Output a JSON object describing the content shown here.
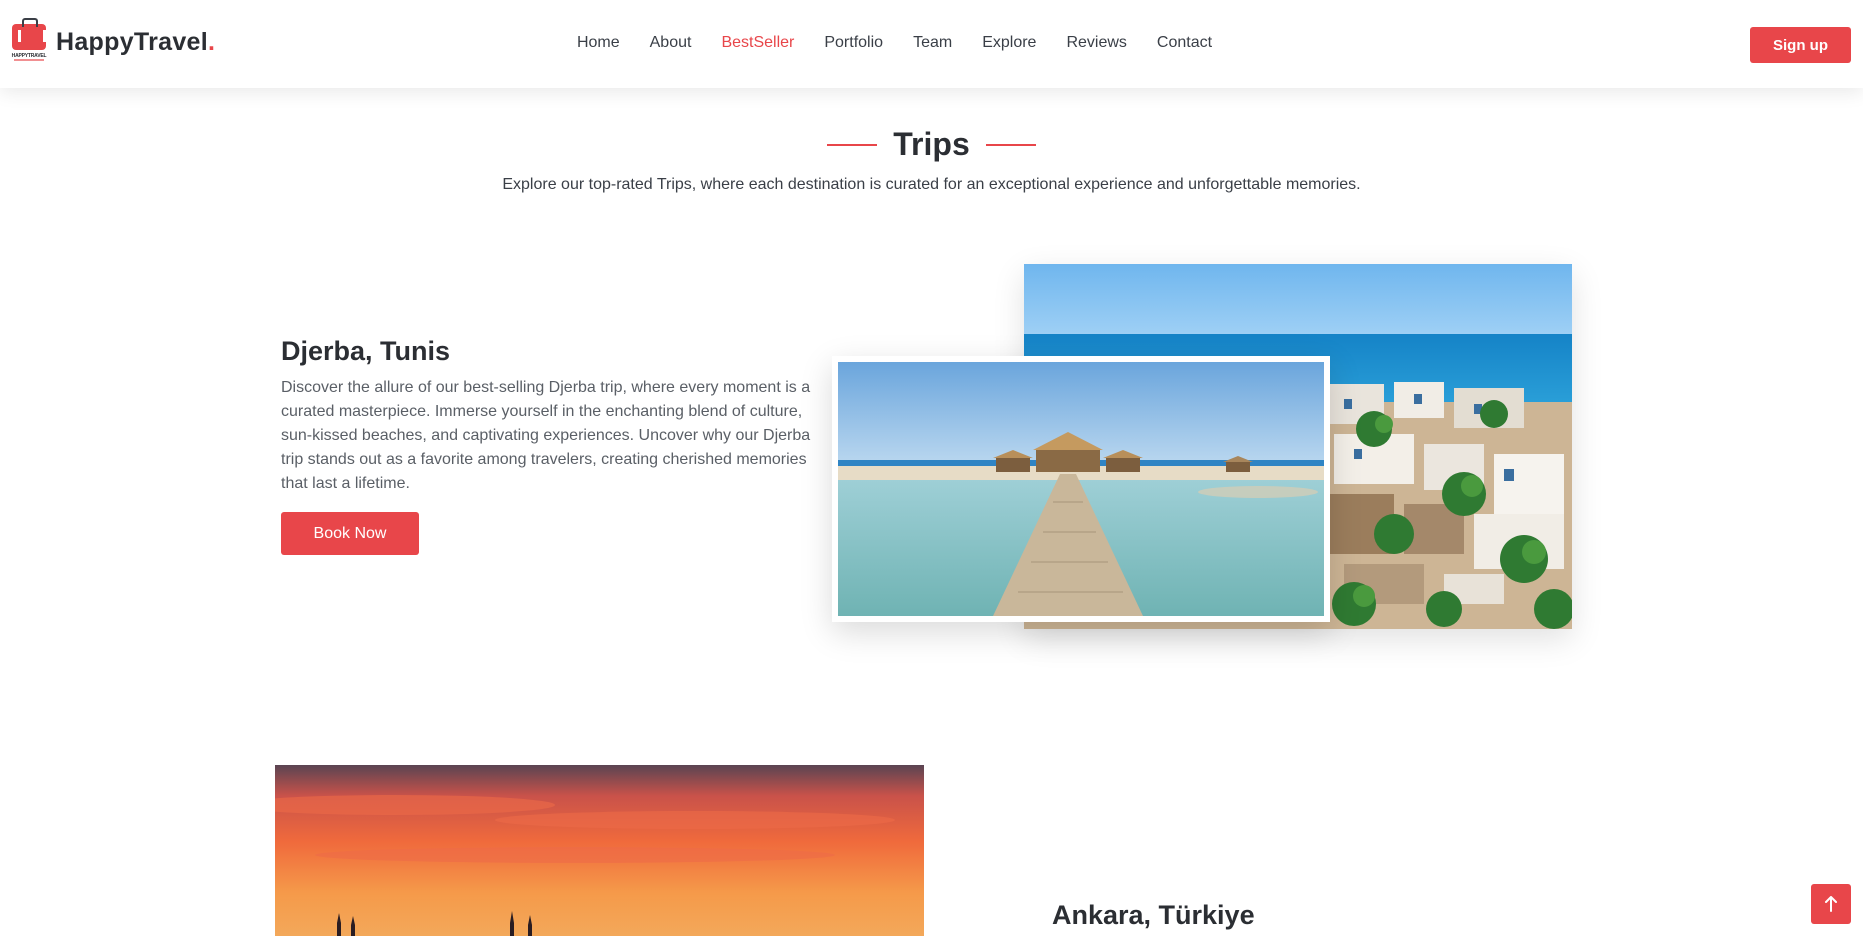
{
  "brand": {
    "name": "HappyTravel",
    "dot": ".",
    "logo_text": "HAPPYTRAVEL"
  },
  "nav": {
    "items": [
      {
        "label": "Home"
      },
      {
        "label": "About"
      },
      {
        "label": "BestSeller",
        "active": true
      },
      {
        "label": "Portfolio"
      },
      {
        "label": "Team"
      },
      {
        "label": "Explore"
      },
      {
        "label": "Reviews"
      },
      {
        "label": "Contact"
      }
    ],
    "signup_label": "Sign up"
  },
  "section": {
    "title": "Trips",
    "subtitle": "Explore our top-rated Trips, where each destination is curated for an exceptional experience and unforgettable memories."
  },
  "trips": [
    {
      "title": "Djerba, Tunis",
      "description": "Discover the allure of our best-selling Djerba trip, where every moment is a curated masterpiece. Immerse yourself in the enchanting blend of culture, sun-kissed beaches, and captivating experiences. Uncover why our Djerba trip stands out as a favorite among travelers, creating cherished memories that last a lifetime.",
      "button_label": "Book Now"
    },
    {
      "title": "Ankara, Türkiye"
    }
  ],
  "colors": {
    "accent": "#e8464a",
    "text": "#2b2e33"
  },
  "icons": {
    "scroll_top": "arrow-up-icon"
  }
}
